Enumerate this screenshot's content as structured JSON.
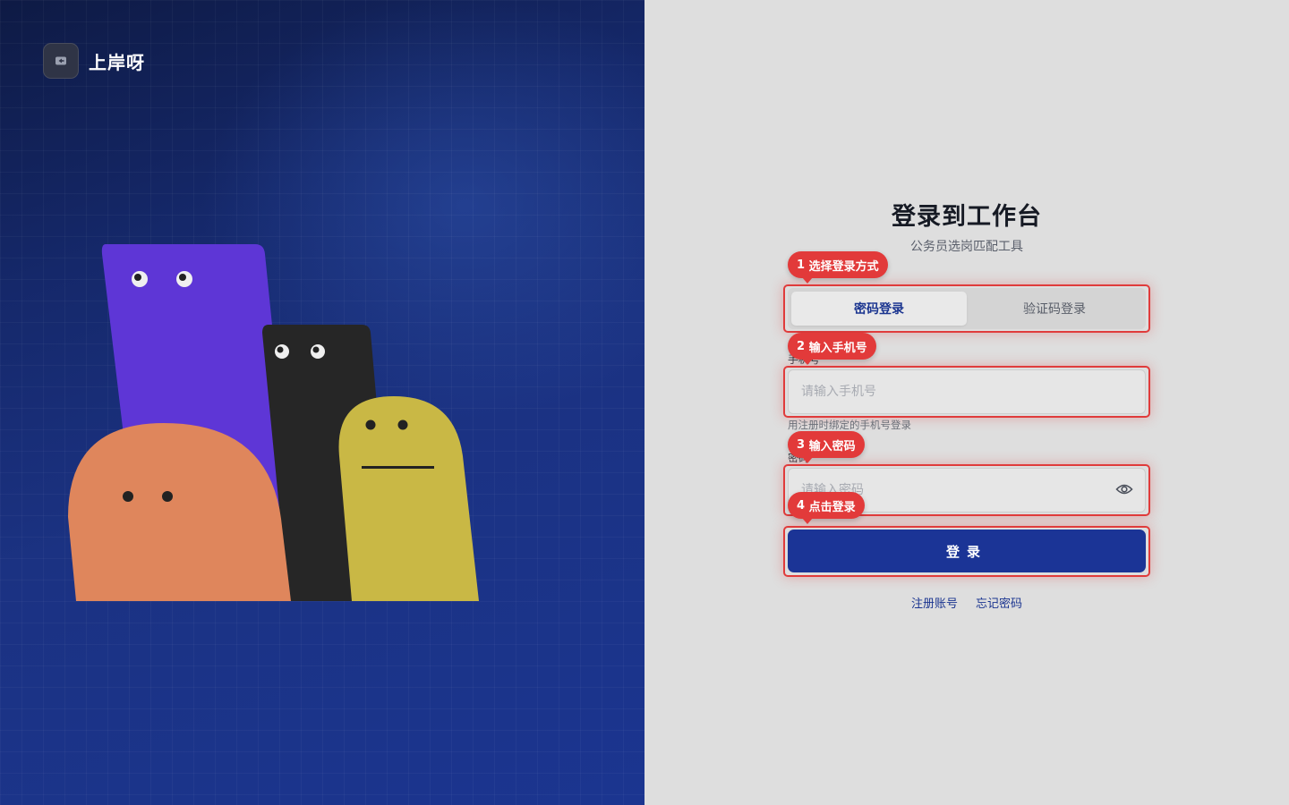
{
  "brand": {
    "name": "上岸呀",
    "logo_icon": "back-arrow-icon"
  },
  "login": {
    "title": "登录到工作台",
    "subtitle": "公务员选岗匹配工具",
    "tabs": [
      {
        "label": "密码登录",
        "active": true
      },
      {
        "label": "验证码登录",
        "active": false
      }
    ],
    "phone": {
      "label": "手机号",
      "placeholder": "请输入手机号",
      "value": "",
      "hint": "用注册时绑定的手机号登录"
    },
    "password": {
      "label": "密码",
      "placeholder": "请输入密码",
      "value": "",
      "toggle_icon": "eye-icon"
    },
    "submit_label": "登录",
    "links": {
      "register": "注册账号",
      "forgot": "忘记密码"
    }
  },
  "guide_steps": [
    {
      "step": "1",
      "text": "选择登录方式"
    },
    {
      "step": "2",
      "text": "输入手机号"
    },
    {
      "step": "3",
      "text": "输入密码"
    },
    {
      "step": "4",
      "text": "点击登录"
    }
  ],
  "colors": {
    "primary": "#1b3496",
    "highlight": "#e23a3a",
    "left_bg": "#1b3282",
    "character_purple": "#5e36d6",
    "character_black": "#262626",
    "character_yellow": "#c9b845",
    "character_orange": "#df865c"
  }
}
